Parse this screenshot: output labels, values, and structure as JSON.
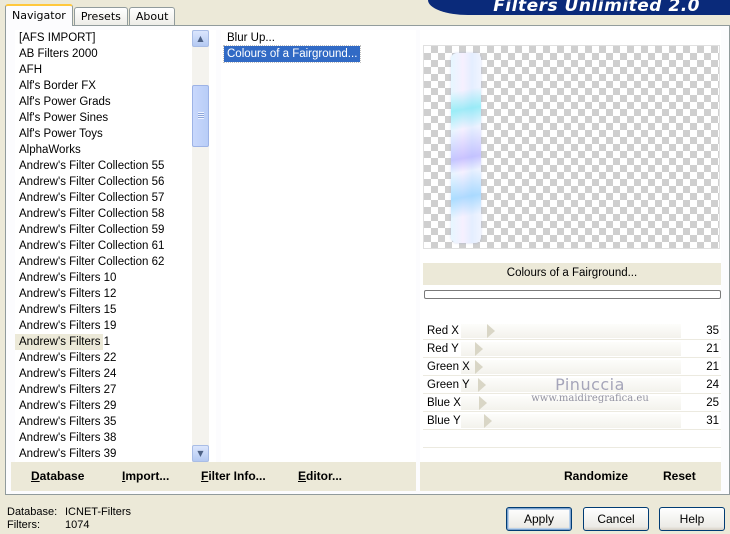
{
  "tabs": [
    {
      "label": "Navigator",
      "active": true
    },
    {
      "label": "Presets",
      "active": false
    },
    {
      "label": "About",
      "active": false
    }
  ],
  "banner": {
    "title": "Filters Unlimited 2.0"
  },
  "categories": {
    "items": [
      "[AFS IMPORT]",
      "AB Filters 2000",
      "AFH",
      "Alf's Border FX",
      "Alf's Power Grads",
      "Alf's Power Sines",
      "Alf's Power Toys",
      "AlphaWorks",
      "Andrew's Filter Collection 55",
      "Andrew's Filter Collection 56",
      "Andrew's Filter Collection 57",
      "Andrew's Filter Collection 58",
      "Andrew's Filter Collection 59",
      "Andrew's Filter Collection 61",
      "Andrew's Filter Collection 62",
      "Andrew's Filters 10",
      "Andrew's Filters 12",
      "Andrew's Filters 15",
      "Andrew's Filters 19",
      "Andrew's Filters 1",
      "Andrew's Filters 22",
      "Andrew's Filters 24",
      "Andrew's Filters 27",
      "Andrew's Filters 29",
      "Andrew's Filters 35",
      "Andrew's Filters 38",
      "Andrew's Filters 39"
    ],
    "selected": "Andrew's Filters 1"
  },
  "filters": {
    "items": [
      "Blur Up...",
      "Colours of a Fairground..."
    ],
    "selected": "Colours of a Fairground..."
  },
  "preview": {
    "effect_name": "Colours of a Fairground...",
    "progress": 0
  },
  "params": [
    {
      "name": "Red X",
      "value": "35",
      "fraction": 0.137
    },
    {
      "name": "Red Y",
      "value": "21",
      "fraction": 0.082
    },
    {
      "name": "Green X",
      "value": "21",
      "fraction": 0.082
    },
    {
      "name": "Green Y",
      "value": "24",
      "fraction": 0.094
    },
    {
      "name": "Blue X",
      "value": "25",
      "fraction": 0.098
    },
    {
      "name": "Blue Y",
      "value": "31",
      "fraction": 0.122
    }
  ],
  "watermark": {
    "line1": "Pinuccia",
    "line2": "www.maidiregrafica.eu"
  },
  "left_buttons": [
    "Database",
    "Import...",
    "Filter Info...",
    "Editor..."
  ],
  "right_buttons": [
    "Randomize",
    "Reset"
  ],
  "status": {
    "database_label": "Database:",
    "database_value": "ICNET-Filters",
    "filters_label": "Filters:",
    "filters_value": "1074"
  },
  "dialog_buttons": {
    "apply": "Apply",
    "cancel": "Cancel",
    "help": "Help"
  },
  "colors": {
    "selection": "#316ac5",
    "banner": "#0a2a7a",
    "face": "#ece9d8"
  }
}
